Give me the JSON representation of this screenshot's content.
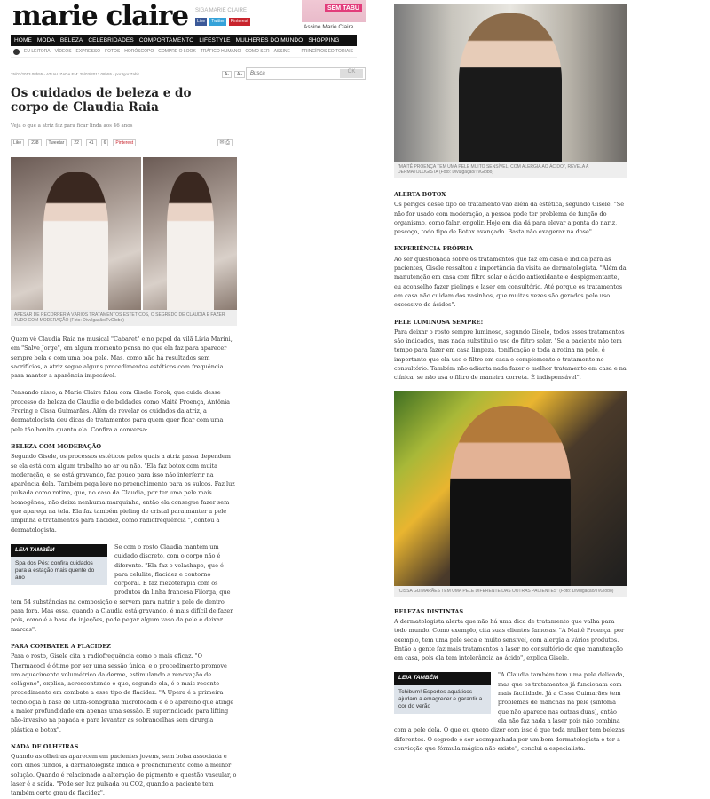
{
  "header": {
    "logo": "marie claire",
    "follow_label": "SIGA MARIE CLAIRE",
    "social": [
      "Like",
      "Twitter",
      "Pinterest"
    ],
    "subscribe_label": "Assine Marie Claire",
    "promo_tag": "SEM TABU",
    "promo_cta": "Assine Marie Claire"
  },
  "nav": {
    "main": [
      "HOME",
      "MODA",
      "BELEZA",
      "CELEBRIDADES",
      "COMPORTAMENTO",
      "LIFESTYLE",
      "MULHERES DO MUNDO",
      "SHOPPING"
    ],
    "sub": [
      "EU LEITORA",
      "VÍDEOS",
      "EXPRESSO",
      "FOTOS",
      "HORÓSCOPO",
      "COMPRE O LOOK",
      "TRÁFICO HUMANO",
      "COMO SER",
      "ASSINE"
    ],
    "sub_right": "PRINCÍPIOS EDITORIAIS"
  },
  "article_meta": {
    "date_line": "25/03/2013 08h55 - ATUALIZADA EM: 25/03/2013 08h55 - por Igor Zahir",
    "font_small": "A-",
    "font_large": "A+"
  },
  "search": {
    "placeholder": "Busca",
    "button": "OK"
  },
  "article": {
    "title": "Os cuidados de beleza e do corpo de Claudia Raia",
    "subtitle": "Veja o que a atriz faz para ficar linda aos 46 anos",
    "share": {
      "like": "Like",
      "like_count": "238",
      "tweet": "Tweetar",
      "tweet_count": "22",
      "plus": "+1",
      "plus_count": "6",
      "pinterest": "Pinterest"
    },
    "hero_caption": "APESAR DE RECORRER A VÁRIOS TRATAMENTOS ESTÉTICOS, O SEGREDO DE CLAUDIA É FAZER TUDO COM MODERAÇÃO (Foto: Divulgação/TvGlobo)",
    "p1": "Quem vê Claudia Raia no musical \"Cabaret\" e no papel da vilã Lívia Marini, em \"Salve Jorge\", em algum momento pensa no que ela faz para aparecer sempre bela e com uma boa pele. Mas, como não há resultados sem sacrifícios, a atriz segue alguns procedimentos estéticos com frequência para manter a aparência impecável.",
    "p2": "Pensando nisso, a Marie Claire falou com Gisele Torok, que cuida desse processo de beleza de Claudia e de beldades como Maitê Proença, Antônia Frering e Cissa Guimarães. Além de revelar os cuidados da atriz, a dermatologista deu dicas de tratamentos para quem quer ficar com uma pele tão bonita quanto ela. Confira a conversa:",
    "h1": "BELEZA COM MODERAÇÃO",
    "p3": "Segundo Gisele, os processos estéticos pelos quais a atriz passa dependem se ela está com algum trabalho no ar ou não. \"Ela faz botox com muita moderação, e, se está gravando, faz pouco para isso não interferir na aparência dela. Também pega leve no preenchimento para os sulcos. Faz luz pulsada como rotina, que, no caso da Claudia, por ter uma pele mais homogênea, não deixa nenhuma marquinha, então ela consegue fazer sem que apareça na tela. Ela faz também pieling de cristal para manter a pele limpinha e tratamentos para flacidez, como radiofrequência \", contou a dermatologista.",
    "related1_label": "LEIA TAMBÉM",
    "related1_text": "Spa dos Pés: confira cuidados para a estação mais quente do ano",
    "p4": "Se com o rosto Claudia mantém um cuidado discreto, com o corpo não é diferente. \"Ela faz o velashape, que é para celulite, flacidez e contorno corporal. E faz mezoterapia com os produtos da linha francesa Filorga, que tem 54 substâncias na composição e servem para nutrir a pele de dentro para fora. Mas essa, quando a Claudia está gravando, é mais difícil de fazer pois, como é a base de injeções, pode pegar algum vaso da pele e deixar marcas\".",
    "h2": "PARA COMBATER A FLACIDEZ",
    "p5": "Para o rosto, Gisele cita a radiofrequência como o mais eficaz. \"O Thermacool é ótimo por ser uma sessão única, e o procedimento promove um aquecimento volumétrico da derme, estimulando a renovação de colágeno\", explica, acrescentando o que, segundo ela, é o mais recente procedimento em combate a esse tipo de flacidez. \"A Upera é a primeira tecnologia à base de ultra-sonografia microfocada e é o aparelho que atinge a maior profundidade em apenas uma sessão. É superindicado para lifting não-invasivo na papada e para levantar as sobrancelhas sem cirurgia plástica e botox\".",
    "h3": "NADA DE OLHEIRAS",
    "p6": "Quando as olheiras aparecem em pacientes jovens, sem bolsa associada e com olhos fundos, a dermatologista indica o preenchimento como a melhor solução. Quando é relacionado a alteração de pigmento e questão vascular, o laser é a saída. \"Pode ser luz pulsada ou CO2, quando a paciente tem também certo grau de flacidez\".",
    "photo2_caption": "\"MAITÊ PROENÇA TEM UMA PELE MUITO SENSÍVEL, COM ALERGIA AO ÁCIDO\", REVELA A DERMATOLOGISTA (Foto: Divulgação/TvGlobo)",
    "h4": "ALERTA BOTOX",
    "p7": "Os perigos desse tipo de tratamento vão além da estética, segundo Gisele. \"Se não for usado com moderação, a pessoa pode ter problema de função do organismo, como falar, engolir. Hoje em dia dá para elevar a ponta do nariz, pescoço, todo tipo de Botox avançado. Basta não exagerar na dose\".",
    "h5": "EXPERIÊNCIA PRÓPRIA",
    "p8": "Ao ser questionada sobre os tratamentos que faz em casa e indica para as pacientes, Gisele ressaltou a importância da visita ao dermatologista. \"Além da manutenção em casa com filtro solar e ácido antioxidante e despigmentante, eu aconselho fazer pielings e laser em consultório. Até porque os tratamentos em casa não cuidam dos vasinhos, que muitas vezes são gerados pelo uso excessivo de ácidos\".",
    "h6": "PELE LUMINOSA SEMPRE!",
    "p9": "Para deixar o rosto sempre luminoso, segundo Gisele, todos esses tratamentos são indicados, mas nada substitui o uso do filtro solar. \"Se a paciente não tem tempo para fazer em casa limpeza, tonificação e toda a rotina na pele, é importante que ela use o filtro em casa e complemente o tratamento no consultório. Também não adianta nada fazer o melhor tratamento em casa e na clínica, se não usa o filtro de maneira correta. É indispensável\".",
    "photo3_caption": "\"CISSA GUIMARÃES TEM UMA PELE DIFERENTE DAS OUTRAS PACIENTES\" (Foto: Divulgação/TvGlobo)",
    "h7": "BELEZAS DISTINTAS",
    "p10": "A dermatologista alerta que não há uma dica de tratamento que valha para todo mundo. Como exemplo, cita suas clientes famosas. \"A Maitê Proença, por exemplo, tem uma pele seca e muito sensível, com alergia a vários produtos. Então a gente faz mais tratamentos a laser no consultório do que manutenção em casa, pois ela tem intolerância ao ácido\", explica Gisele.",
    "related2_label": "LEIA TAMBÉM",
    "related2_text": "Tchibum! Esportes aquáticos ajudam a emagrecer e garantir a cor do verão",
    "p11": "\"A Claudia também tem uma pele delicada, mas que os tratamentos já funcionam com mais facilidade. Já a Cissa Guimarães tem problemas de manchas na pele (sintoma que não aparece nas outras duas), então ela não faz nada a laser pois não combina com a pele dela. O que eu quero dizer com isso é que toda mulher tem belezas diferentes. O segredo é ser acompanhada por um bom dermatologista e ter a convicção que fórmula mágica não existe\", conclui a especialista."
  }
}
